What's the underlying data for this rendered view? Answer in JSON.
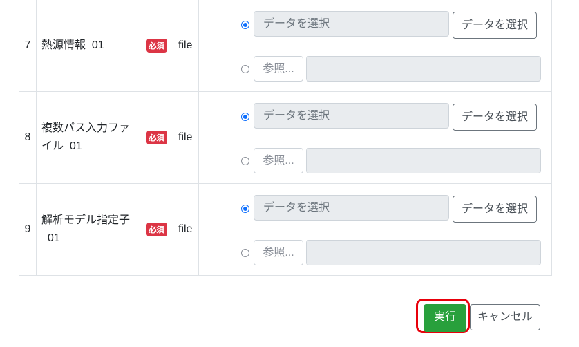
{
  "rows": [
    {
      "no": "7",
      "name": "熱源情報_01",
      "required": "必須",
      "type": "file",
      "select_placeholder": "データを選択",
      "select_button": "データを選択",
      "browse_button": "参照..."
    },
    {
      "no": "8",
      "name": "複数パス入力ファイル_01",
      "required": "必須",
      "type": "file",
      "select_placeholder": "データを選択",
      "select_button": "データを選択",
      "browse_button": "参照..."
    },
    {
      "no": "9",
      "name": "解析モデル指定子_01",
      "required": "必須",
      "type": "file",
      "select_placeholder": "データを選択",
      "select_button": "データを選択",
      "browse_button": "参照..."
    }
  ],
  "actions": {
    "run": "実行",
    "cancel": "キャンセル"
  },
  "colors": {
    "run": "#28a03c",
    "highlight": "#e8000b",
    "badge": "#dc3545"
  }
}
